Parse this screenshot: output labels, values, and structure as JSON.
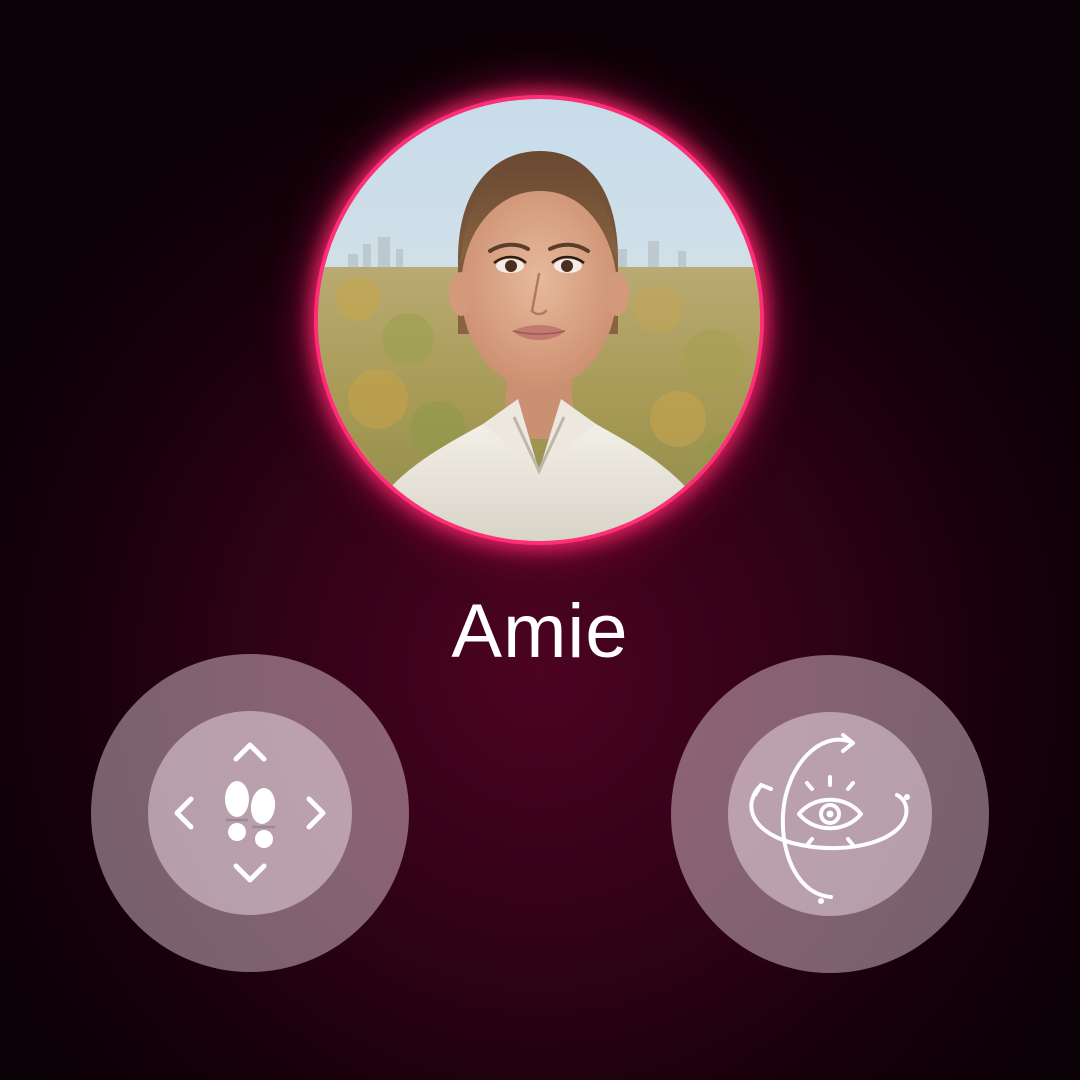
{
  "profile": {
    "name": "Amie"
  },
  "controls": {
    "move": {
      "icon": "footsteps-move-arrows-icon"
    },
    "look": {
      "icon": "eye-orbit-look-around-icon"
    }
  },
  "colors": {
    "accent_glow": "#ff2e77",
    "background": "#2e0215",
    "control_fill": "#f0d7e4"
  }
}
